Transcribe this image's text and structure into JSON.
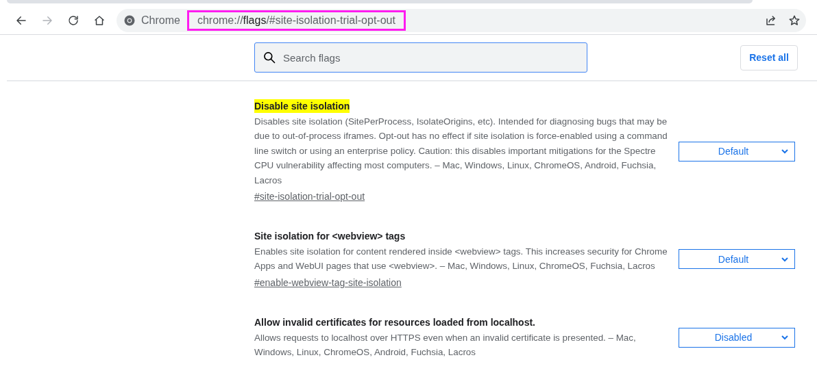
{
  "toolbar": {
    "site_label": "Chrome",
    "url": "chrome://**flags**/#site-isolation-trial-opt-out",
    "url_outlined": true,
    "forward_disabled": true
  },
  "search": {
    "placeholder": "Search flags"
  },
  "reset_button": "Reset all",
  "flags": [
    {
      "title": "Disable site isolation",
      "highlighted": true,
      "description": "Disables site isolation (SitePerProcess, IsolateOrigins, etc). Intended for diagnosing bugs that may be due to out-of-process iframes. Opt-out has no effect if site isolation is force-enabled using a command line switch or using an enterprise policy. Caution: this disables important mitigations for the Spectre CPU vulnerability affecting most computers. – Mac, Windows, Linux, ChromeOS, Android, Fuchsia, Lacros",
      "link": "#site-isolation-trial-opt-out",
      "value": "Default"
    },
    {
      "title": "Site isolation for <webview> tags",
      "highlighted": false,
      "description": "Enables site isolation for content rendered inside <webview> tags. This increases security for Chrome Apps and WebUI pages that use <webview>. – Mac, Windows, Linux, ChromeOS, Fuchsia, Lacros",
      "link": "#enable-webview-tag-site-isolation",
      "value": "Default"
    },
    {
      "title": "Allow invalid certificates for resources loaded from localhost.",
      "highlighted": false,
      "description": "Allows requests to localhost over HTTPS even when an invalid certificate is presented. – Mac, Windows, Linux, ChromeOS, Android, Fuchsia, Lacros",
      "value": "Disabled"
    }
  ]
}
